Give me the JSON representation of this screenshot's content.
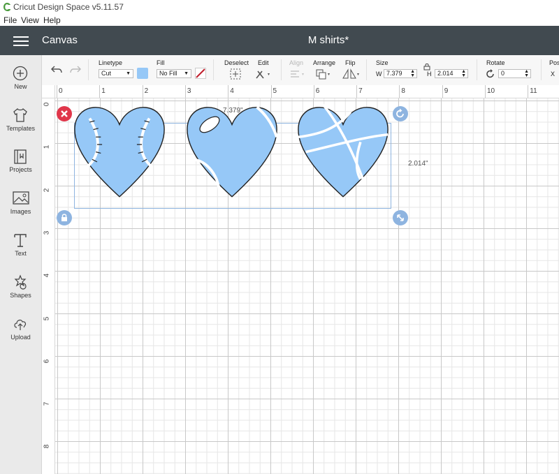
{
  "app": {
    "title": "Cricut Design Space  v5.11.57"
  },
  "menu": [
    "File",
    "View",
    "Help"
  ],
  "header": {
    "section": "Canvas",
    "project": "M shirts*"
  },
  "toolbar": {
    "linetype_label": "Linetype",
    "linetype_value": "Cut",
    "fill_label": "Fill",
    "fill_value": "No Fill",
    "deselect_label": "Deselect",
    "edit_label": "Edit",
    "align_label": "Align",
    "arrange_label": "Arrange",
    "flip_label": "Flip",
    "size_label": "Size",
    "w_label": "W",
    "w_value": "7.379",
    "h_label": "H",
    "h_value": "2.014",
    "rotate_label": "Rotate",
    "rotate_value": "0",
    "position_label": "Pos",
    "x_label": "X"
  },
  "sidebar": {
    "items": [
      {
        "label": "New",
        "icon": "plus-circle-icon"
      },
      {
        "label": "Templates",
        "icon": "tshirt-icon"
      },
      {
        "label": "Projects",
        "icon": "projects-icon"
      },
      {
        "label": "Images",
        "icon": "image-icon"
      },
      {
        "label": "Text",
        "icon": "text-icon"
      },
      {
        "label": "Shapes",
        "icon": "shapes-icon"
      },
      {
        "label": "Upload",
        "icon": "upload-cloud-icon"
      }
    ]
  },
  "ruler": {
    "top": [
      "0",
      "1",
      "2",
      "3",
      "4",
      "5",
      "6",
      "7",
      "8",
      "9",
      "10",
      "11"
    ],
    "left": [
      "0",
      "1",
      "2",
      "3",
      "4",
      "5",
      "6",
      "7",
      "8"
    ]
  },
  "selection": {
    "width_text": "7.379\"",
    "height_text": "2.014\""
  },
  "colors": {
    "header": "#414a50",
    "fill_swatch": "#96c8f7",
    "heart_fill": "#96c8f7",
    "delete": "#e0364a",
    "handle": "#8eb4e0"
  }
}
